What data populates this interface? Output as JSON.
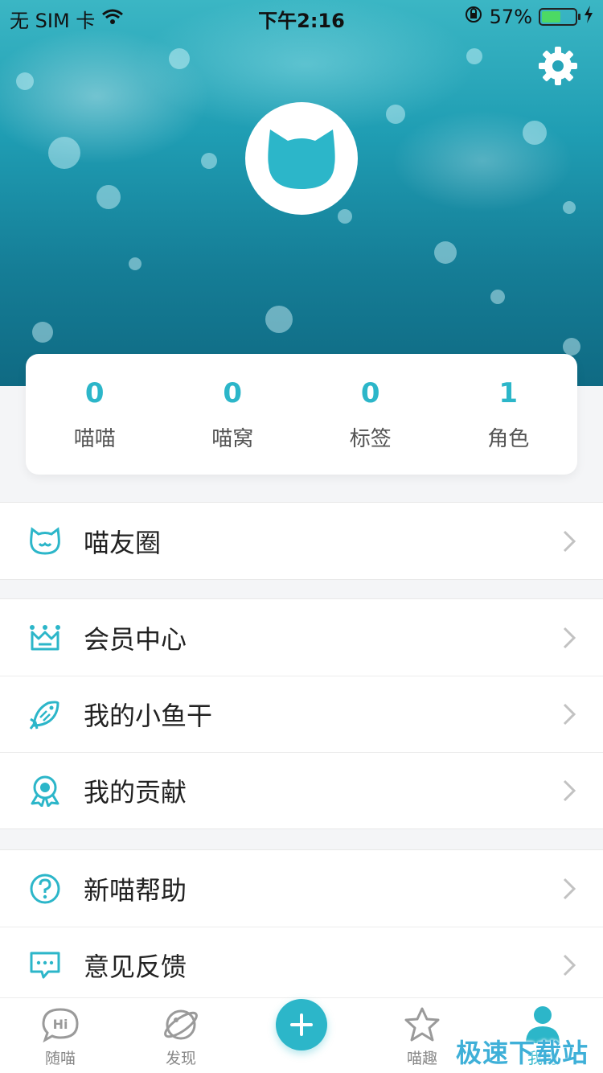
{
  "status_bar": {
    "carrier": "无 SIM 卡",
    "time": "下午2:16",
    "battery_percent": "57%",
    "battery_level": 0.57
  },
  "colors": {
    "accent": "#2cb6c9",
    "hero_bg": "#1f9db3"
  },
  "stats": [
    {
      "value": "0",
      "label": "喵喵"
    },
    {
      "value": "0",
      "label": "喵窝"
    },
    {
      "value": "0",
      "label": "标签"
    },
    {
      "value": "1",
      "label": "角色"
    }
  ],
  "menu": {
    "group1": [
      {
        "label": "喵友圈",
        "icon": "cat-face-icon"
      }
    ],
    "group2": [
      {
        "label": "会员中心",
        "icon": "crown-icon"
      },
      {
        "label": "我的小鱼干",
        "icon": "fish-icon"
      },
      {
        "label": "我的贡献",
        "icon": "medal-icon"
      }
    ],
    "group3": [
      {
        "label": "新喵帮助",
        "icon": "question-icon"
      },
      {
        "label": "意见反馈",
        "icon": "feedback-icon"
      }
    ]
  },
  "tabbar": {
    "tabs": [
      {
        "label": "随喵",
        "icon": "hi-bubble-icon"
      },
      {
        "label": "发现",
        "icon": "planet-icon"
      },
      {
        "label": "",
        "icon": "plus-icon"
      },
      {
        "label": "喵趣",
        "icon": "star-icon"
      },
      {
        "label": "我的",
        "icon": "user-icon"
      }
    ]
  },
  "watermark": "极速下载站"
}
